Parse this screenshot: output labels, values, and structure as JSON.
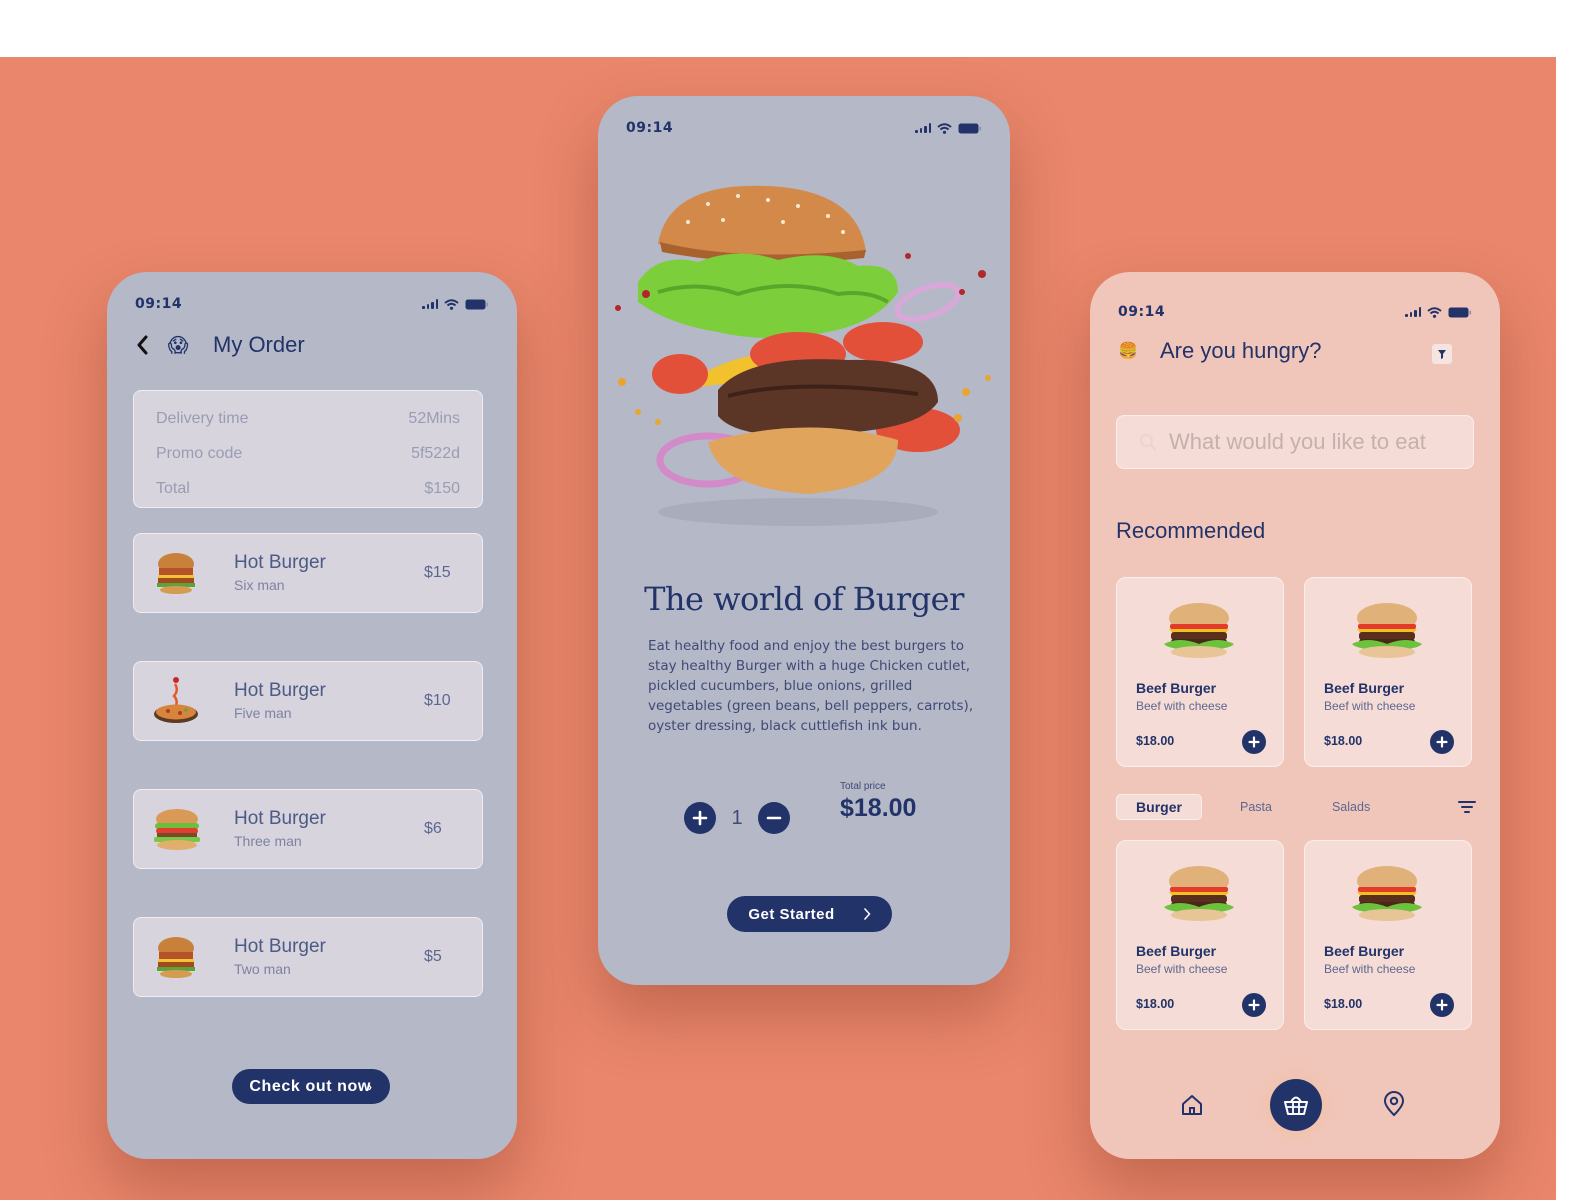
{
  "colors": {
    "background": "#e9866b",
    "primary": "#22336a",
    "grey_phone": "#b5b8c6",
    "pink_phone": "#f1c6ba"
  },
  "status_bar": {
    "time": "09:14",
    "icons": [
      "signal-icon",
      "wifi-icon",
      "battery-icon"
    ]
  },
  "order_screen": {
    "title": "My Order",
    "title_emoji": "😱",
    "summary": [
      {
        "label": "Delivery time",
        "value": "52Mins"
      },
      {
        "label": "Promo code",
        "value": "5f522d"
      },
      {
        "label": "Total",
        "value": "$150"
      }
    ],
    "items": [
      {
        "name": "Hot Burger",
        "subtitle": "Six man",
        "price": "$15",
        "image": "chicken-burger"
      },
      {
        "name": "Hot Burger",
        "subtitle": "Five man",
        "price": "$10",
        "image": "pizza"
      },
      {
        "name": "Hot Burger",
        "subtitle": "Three man",
        "price": "$6",
        "image": "veggie-burger"
      },
      {
        "name": "Hot Burger",
        "subtitle": "Two man",
        "price": "$5",
        "image": "chicken-burger"
      }
    ],
    "checkout_label": "Check out now"
  },
  "intro_screen": {
    "title": "The world of Burger",
    "description": "Eat healthy food and enjoy the best burgers to stay healthy Burger with a huge Chicken  cutlet, pickled cucumbers, blue onions, grilled vegetables (green beans, bell peppers, carrots), oyster dressing, black cuttlefish ink bun.",
    "quantity": "1",
    "total_price_label": "Total price",
    "total_price": "$18.00",
    "cta_label": "Get Started"
  },
  "home_screen": {
    "greeting": "Are you hungry?",
    "greeting_emoji": "🍔",
    "search_placeholder": "What would you like to eat",
    "section_title": "Recommended",
    "recommended": [
      {
        "name": "Beef Burger",
        "subtitle": "Beef with cheese",
        "price": "$18.00"
      },
      {
        "name": "Beef Burger",
        "subtitle": "Beef with cheese",
        "price": "$18.00"
      }
    ],
    "tabs": [
      {
        "label": "Burger",
        "active": true
      },
      {
        "label": "Pasta",
        "active": false
      },
      {
        "label": "Salads",
        "active": false
      }
    ],
    "products": [
      {
        "name": "Beef Burger",
        "subtitle": "Beef with cheese",
        "price": "$18.00"
      },
      {
        "name": "Beef Burger",
        "subtitle": "Beef with cheese",
        "price": "$18.00"
      }
    ],
    "nav": [
      "home-icon",
      "basket-icon",
      "location-icon"
    ]
  }
}
